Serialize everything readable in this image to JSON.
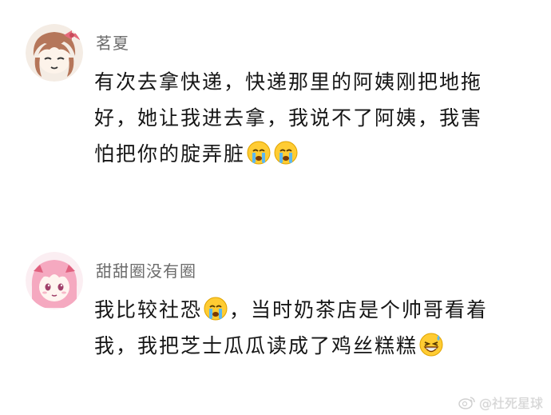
{
  "comments": [
    {
      "username": "茗夏",
      "text_lines": [
        "有次去拿快递，快递那里的阿姨刚把地拖",
        "好，她让我进去拿，我说不了阿姨，我害",
        "怕把你的腚弄脏"
      ],
      "trailing_emojis": [
        "crying-emoji",
        "crying-emoji"
      ]
    },
    {
      "username": "甜甜圈没有圈",
      "segment_1": "我比较社恐",
      "segment_2": "，当时奶茶店是个帅哥看着",
      "segment_3": "我，我把芝士瓜瓜读成了鸡丝糕糕",
      "emojis": [
        "crying-emoji",
        "grinning-sweat-emoji"
      ]
    }
  ],
  "watermark": {
    "text": "@社死星球",
    "icon": "weibo-icon"
  },
  "colors": {
    "username": "#6b6b6b",
    "text": "#161616",
    "watermark": "#d6d6d6"
  }
}
